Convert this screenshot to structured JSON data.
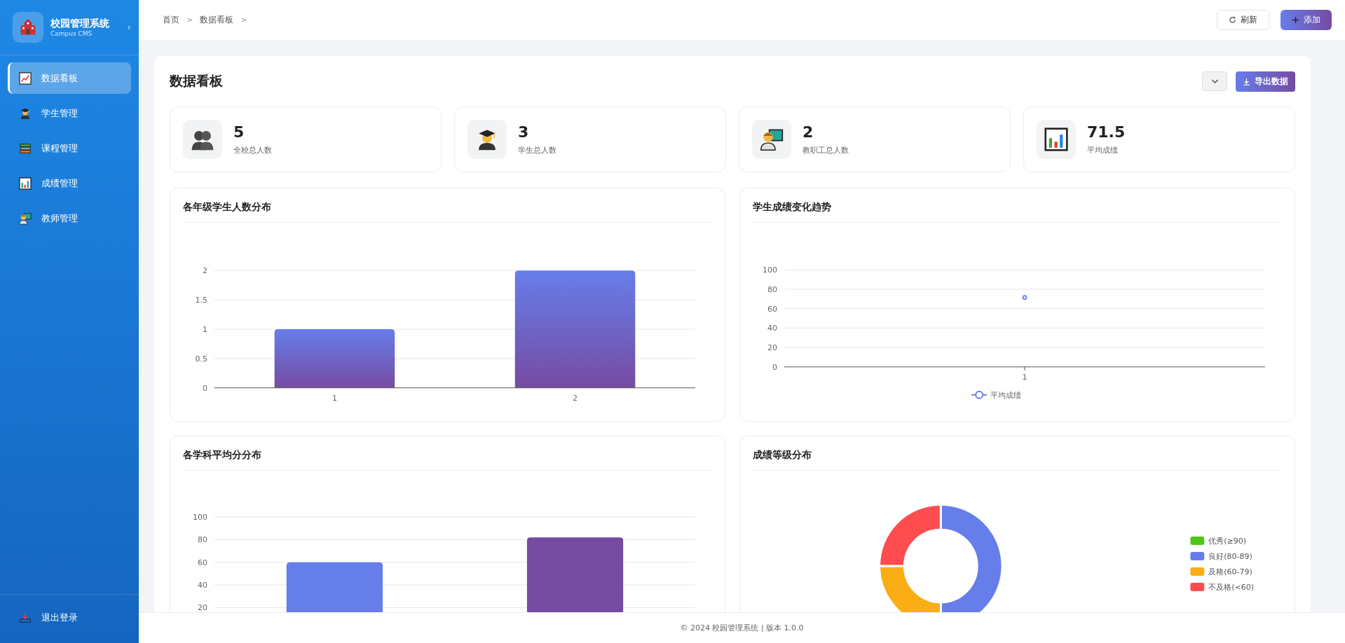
{
  "sidebar": {
    "logo": {
      "title": "校园管理系统",
      "subtitle": "Campus CMS",
      "toggle": "›"
    },
    "items": [
      {
        "label": "数据看板",
        "kind": "trend",
        "selected": true
      },
      {
        "label": "学生管理",
        "kind": "student",
        "selected": false
      },
      {
        "label": "课程管理",
        "kind": "books",
        "selected": false
      },
      {
        "label": "成绩管理",
        "kind": "bars",
        "selected": false
      },
      {
        "label": "教师管理",
        "kind": "teacher",
        "selected": false
      }
    ],
    "logout": "退出登录"
  },
  "header": {
    "breadcrumb": [
      {
        "label": "首页",
        "separator": ">"
      },
      {
        "label": "数据看板",
        "separator": ">"
      }
    ],
    "buttons": [
      {
        "label": "刷新",
        "kind": "refresh"
      },
      {
        "label": "添加",
        "kind": "add"
      }
    ]
  },
  "page": {
    "title": "数据看板",
    "actions": [
      {
        "kind": "dropdown"
      },
      {
        "kind": "export",
        "label": "导出数据"
      }
    ]
  },
  "stats": [
    {
      "value": "5",
      "label": "全校总人数",
      "kind": "people"
    },
    {
      "value": "3",
      "label": "学生总人数",
      "kind": "student"
    },
    {
      "value": "2",
      "label": "教职工总人数",
      "kind": "teacher"
    },
    {
      "value": "71.5",
      "label": "平均成绩",
      "kind": "bars"
    }
  ],
  "charts": [
    {
      "title": "各年级学生人数分布",
      "chart_data": {
        "type": "bar",
        "categories": [
          "1",
          "2"
        ],
        "values": [
          1,
          2
        ],
        "ylim": [
          0,
          2
        ],
        "yticks": [
          0,
          0.5,
          1,
          1.5,
          2
        ],
        "grid": true
      }
    },
    {
      "title": "学生成绩变化趋势",
      "chart_data": {
        "type": "line",
        "x": [
          "1"
        ],
        "series": [
          {
            "name": "平均成绩",
            "color": "#667eea",
            "marker": "circle",
            "values": [
              71.5
            ]
          }
        ],
        "ylim": [
          0,
          100
        ],
        "yticks": [
          0,
          20,
          40,
          60,
          80,
          100
        ],
        "grid": true,
        "legend": "bottom"
      }
    },
    {
      "title": "各学科平均分分布",
      "chart_data": {
        "type": "bar",
        "values": [
          60,
          82
        ],
        "colors": [
          "#667eea",
          "#764ba2"
        ],
        "ylim": [
          0,
          100
        ],
        "yticks": [
          20,
          40,
          60,
          80,
          100
        ],
        "grid": true
      }
    },
    {
      "title": "成绩等级分布",
      "chart_data": {
        "type": "donut",
        "categories": [
          "优秀(≥90)",
          "良好(80-89)",
          "及格(60-79)",
          "不及格(<60)"
        ],
        "values": [
          0,
          50,
          25,
          25
        ],
        "colors": [
          "#52c41a",
          "#667eea",
          "#faad14",
          "#ff4d4f"
        ],
        "legend": "right"
      }
    }
  ],
  "footer": "© 2024 校园管理系统 | 版本 1.0.0"
}
